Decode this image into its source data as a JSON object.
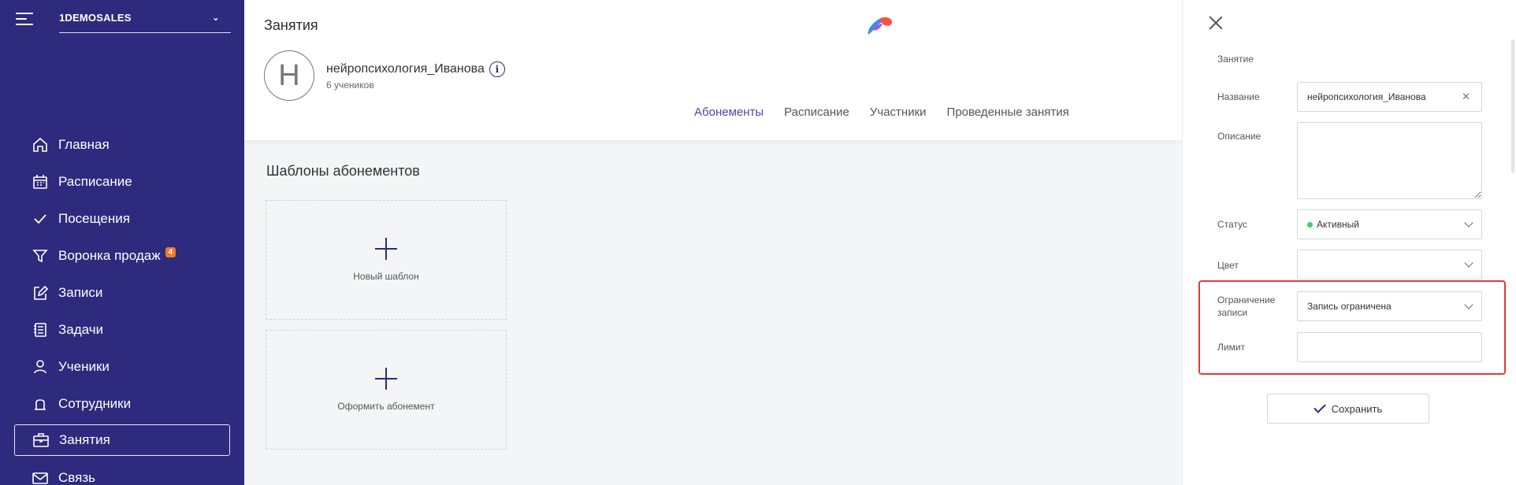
{
  "sidebar": {
    "org_name": "1DEMOSALES",
    "items": [
      {
        "label": "Главная",
        "icon": "home-icon"
      },
      {
        "label": "Расписание",
        "icon": "calendar-icon"
      },
      {
        "label": "Посещения",
        "icon": "check-icon"
      },
      {
        "label": "Воронка продаж",
        "icon": "funnel-icon",
        "badge": "4"
      },
      {
        "label": "Записи",
        "icon": "edit-icon"
      },
      {
        "label": "Задачи",
        "icon": "tasks-icon"
      },
      {
        "label": "Ученики",
        "icon": "user-icon"
      },
      {
        "label": "Сотрудники",
        "icon": "staff-icon"
      },
      {
        "label": "Занятия",
        "icon": "briefcase-icon",
        "active": true
      },
      {
        "label": "Связь",
        "icon": "mail-icon"
      }
    ]
  },
  "header": {
    "title": "Занятия",
    "avatar_letter": "Н",
    "course_name": "нейропсихология_Иванова",
    "students_count": "6 учеников",
    "tabs": [
      {
        "label": "Абонементы",
        "active": true
      },
      {
        "label": "Расписание"
      },
      {
        "label": "Участники"
      },
      {
        "label": "Проведенные занятия"
      }
    ]
  },
  "content": {
    "section_title": "Шаблоны абонементов",
    "cards": [
      {
        "label": "Новый шаблон"
      },
      {
        "label": "Оформить абонемент"
      }
    ]
  },
  "panel": {
    "section_label": "Занятие",
    "name_label": "Название",
    "name_value": "нейропсихология_Иванова",
    "description_label": "Описание",
    "description_value": "",
    "status_label": "Статус",
    "status_value": "Активный",
    "color_label": "Цвет",
    "color_value": "",
    "limit_type_label": "Ограничение записи",
    "limit_type_value": "Запись ограничена",
    "limit_label": "Лимит",
    "limit_value": "",
    "save_label": "Сохранить"
  },
  "colors": {
    "sidebar_bg": "#2e2a7e",
    "accent": "#4b46a6",
    "badge": "#f07a2a",
    "status_active": "#3bd16f",
    "highlight": "#e53935"
  }
}
